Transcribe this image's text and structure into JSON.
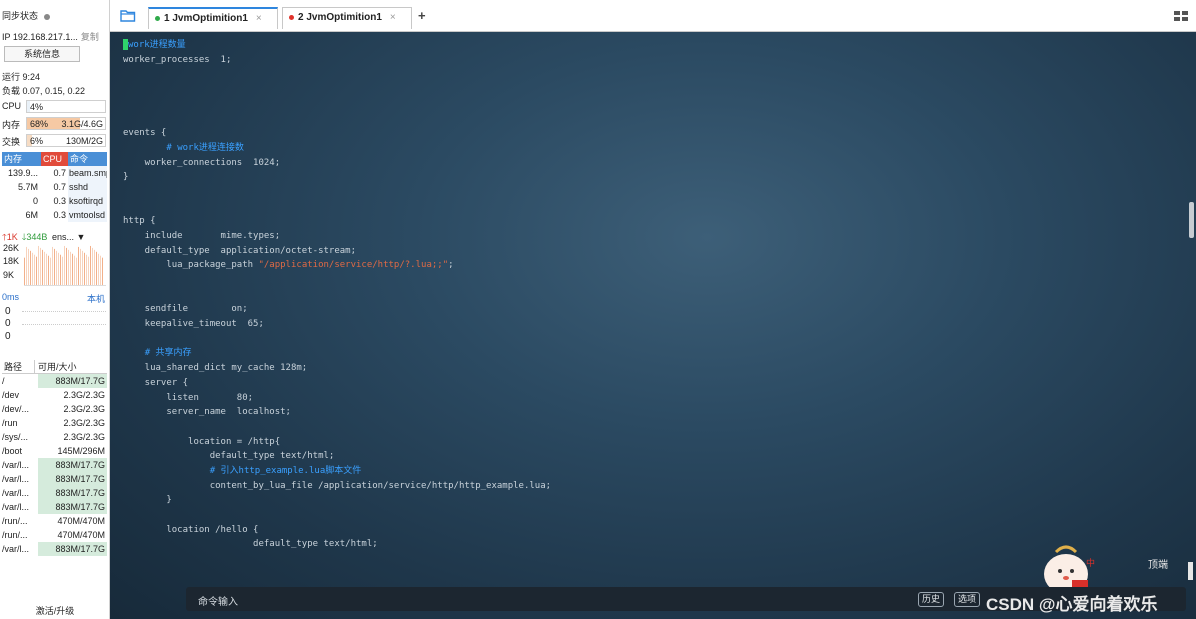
{
  "sidebar": {
    "sync_status": "同步状态",
    "ip": "IP 192.168.217.1...",
    "copy": "复制",
    "sysinfo_button": "系统信息",
    "uptime": "运行 9:24",
    "load": "负载 0.07, 0.15, 0.22",
    "cpu": {
      "label": "CPU",
      "percent": "4%",
      "fraction": 0.04
    },
    "mem": {
      "label": "内存",
      "percent": "68%",
      "value": "3.1G/4.6G",
      "fraction": 0.68
    },
    "swap": {
      "label": "交换",
      "percent": "6%",
      "value": "130M/2G",
      "fraction": 0.06
    },
    "process_headers": {
      "mem": "内存",
      "cpu": "CPU",
      "cmd": "命令"
    },
    "processes": [
      {
        "mem": "139.9...",
        "cpu": "0.7",
        "cmd": "beam.smp"
      },
      {
        "mem": "5.7M",
        "cpu": "0.7",
        "cmd": "sshd"
      },
      {
        "mem": "0",
        "cpu": "0.3",
        "cmd": "ksoftirqd"
      },
      {
        "mem": "6M",
        "cpu": "0.3",
        "cmd": "vmtoolsd"
      }
    ],
    "net": {
      "up": "1K",
      "down": "344B",
      "iface": "ens...",
      "y_ticks": [
        "26K",
        "18K",
        "9K"
      ]
    },
    "latency": {
      "label": "0ms",
      "host": "本机",
      "values": [
        "0",
        "0",
        "0"
      ]
    },
    "disk_headers": {
      "path": "路径",
      "size": "可用/大小"
    },
    "disks": [
      {
        "path": "/",
        "size": "883M/17.7G",
        "hl": true
      },
      {
        "path": "/dev",
        "size": "2.3G/2.3G",
        "hl": false
      },
      {
        "path": "/dev/...",
        "size": "2.3G/2.3G",
        "hl": false
      },
      {
        "path": "/run",
        "size": "2.3G/2.3G",
        "hl": false
      },
      {
        "path": "/sys/...",
        "size": "2.3G/2.3G",
        "hl": false
      },
      {
        "path": "/boot",
        "size": "145M/296M",
        "hl": false
      },
      {
        "path": "/var/l...",
        "size": "883M/17.7G",
        "hl": true
      },
      {
        "path": "/var/l...",
        "size": "883M/17.7G",
        "hl": true
      },
      {
        "path": "/var/l...",
        "size": "883M/17.7G",
        "hl": true
      },
      {
        "path": "/var/l...",
        "size": "883M/17.7G",
        "hl": true
      },
      {
        "path": "/run/...",
        "size": "470M/470M",
        "hl": false
      },
      {
        "path": "/run/...",
        "size": "470M/470M",
        "hl": false
      },
      {
        "path": "/var/l...",
        "size": "883M/17.7G",
        "hl": true
      }
    ],
    "upgrade": "激活/升级"
  },
  "tabs": [
    {
      "label": "1 JvmOptimition1",
      "dot_color": "#2faa4a",
      "active": true
    },
    {
      "label": "2 JvmOptimition1",
      "dot_color": "#e0332b",
      "active": false
    }
  ],
  "terminal": {
    "lines": [
      [
        {
          "t": "",
          "c": "cursor"
        },
        {
          "t": "work进程数量",
          "c": "c-comment"
        }
      ],
      [
        {
          "t": "worker_processes  1;"
        }
      ],
      [],
      [],
      [],
      [],
      [
        {
          "t": "events {"
        }
      ],
      [
        {
          "t": "        "
        },
        {
          "t": "# work进程连接数",
          "c": "c-comment"
        }
      ],
      [
        {
          "t": "    worker_connections  1024;"
        }
      ],
      [
        {
          "t": "}"
        }
      ],
      [],
      [],
      [
        {
          "t": "http {"
        }
      ],
      [
        {
          "t": "    include       mime.types;"
        }
      ],
      [
        {
          "t": "    default_type  application/octet-stream;"
        }
      ],
      [
        {
          "t": "        lua_package_path "
        },
        {
          "t": "\"/application/service/http/?.lua;;\"",
          "c": "c-string"
        },
        {
          "t": ";"
        }
      ],
      [],
      [],
      [
        {
          "t": "    sendfile        on;"
        }
      ],
      [
        {
          "t": "    keepalive_timeout  65;"
        }
      ],
      [],
      [
        {
          "t": "    "
        },
        {
          "t": "# 共享内存",
          "c": "c-comment"
        }
      ],
      [
        {
          "t": "    lua_shared_dict my_cache 128m;"
        }
      ],
      [
        {
          "t": "    server {"
        }
      ],
      [
        {
          "t": "        listen       80;"
        }
      ],
      [
        {
          "t": "        server_name  localhost;"
        }
      ],
      [],
      [
        {
          "t": "            location = /http{"
        }
      ],
      [
        {
          "t": "                default_type text/html;"
        }
      ],
      [
        {
          "t": "                "
        },
        {
          "t": "# 引入http_example.lua脚本文件",
          "c": "c-comment"
        }
      ],
      [
        {
          "t": "                content_by_lua_file /application/service/http/http_example.lua;"
        }
      ],
      [
        {
          "t": "        }"
        }
      ],
      [],
      [
        {
          "t": "        location /hello {"
        }
      ],
      [
        {
          "t": "                        default_type text/html;"
        }
      ]
    ],
    "top_label": "顶端",
    "command_placeholder": "命令输入",
    "history_button": "历史",
    "options_button": "选项",
    "watermark": "CSDN @心爱向着欢乐"
  }
}
